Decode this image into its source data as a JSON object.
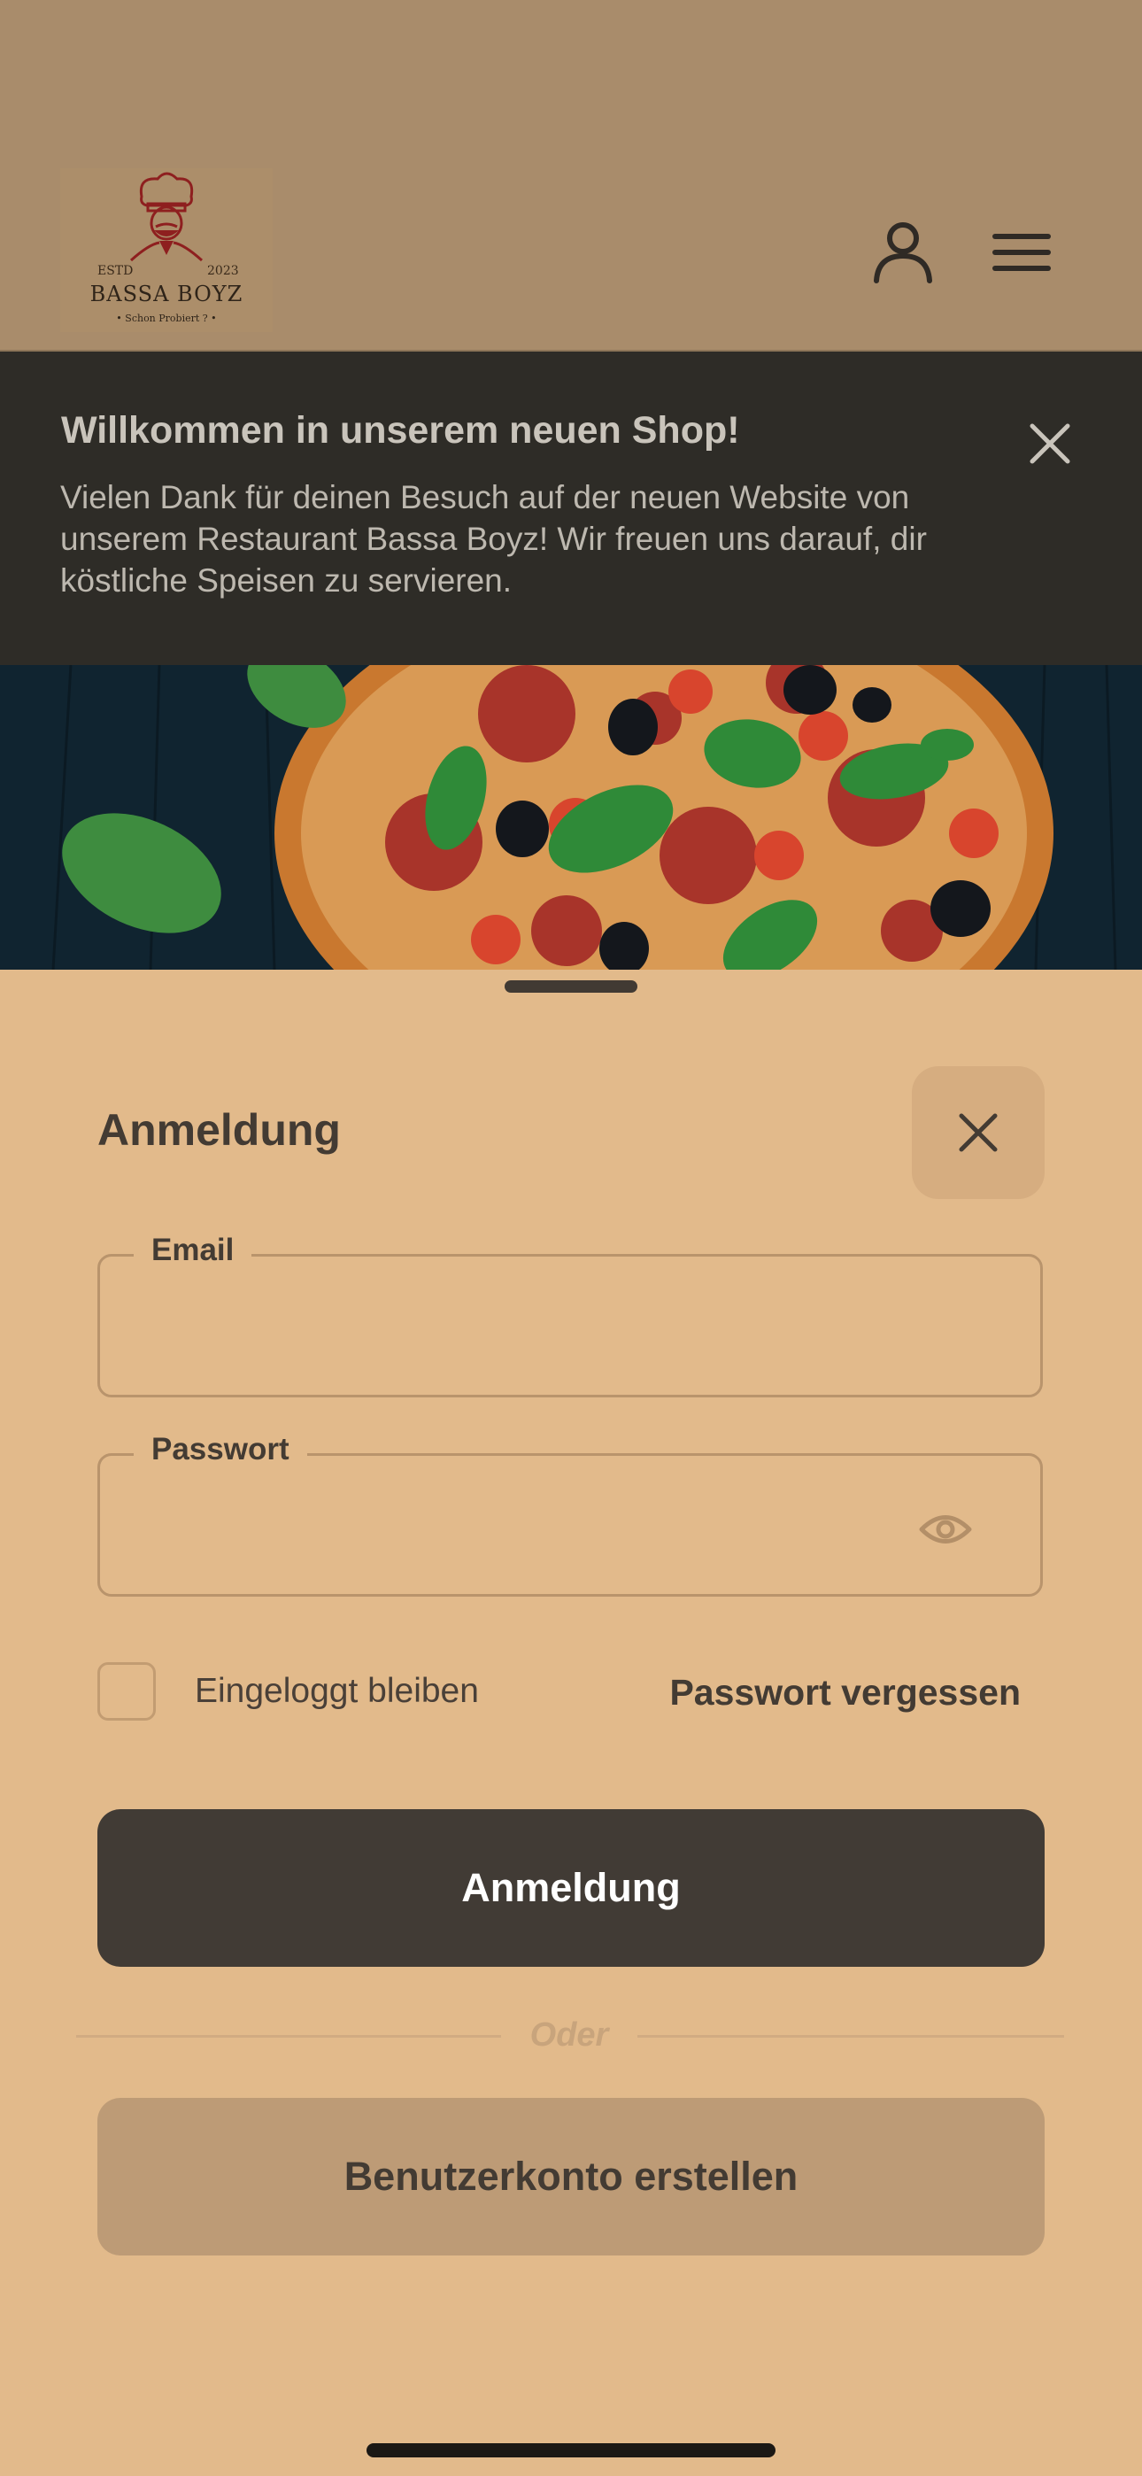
{
  "header": {
    "logo": {
      "estd": "ESTD",
      "year": "2023",
      "name": "BASSA BOYZ",
      "slogan": "• Schon Probiert ? •"
    },
    "account_icon": "person-icon",
    "menu_icon": "hamburger-icon"
  },
  "welcome_banner": {
    "title": "Willkommen in unserem neuen Shop!",
    "text": "Vielen Dank für deinen Besuch auf der neuen Website von unserem Restaurant Bassa Boyz! Wir freuen uns darauf, dir köstliche Speisen zu servieren.",
    "close_icon": "close-icon"
  },
  "login_sheet": {
    "title": "Anmeldung",
    "close_icon": "close-icon",
    "email": {
      "label": "Email",
      "value": "",
      "placeholder": ""
    },
    "password": {
      "label": "Passwort",
      "value": "",
      "placeholder": "",
      "toggle_icon": "eye-icon"
    },
    "remember_me": {
      "label": "Eingeloggt bleiben",
      "checked": false
    },
    "forgot_password": "Passwort vergessen",
    "submit_label": "Anmeldung",
    "divider_text": "Oder",
    "register_label": "Benutzerkonto erstellen"
  },
  "colors": {
    "sheet_background": "#e2ba8b",
    "primary_button": "#413b35",
    "secondary_button": "#bd9b76",
    "banner_background": "#2e2c27"
  }
}
